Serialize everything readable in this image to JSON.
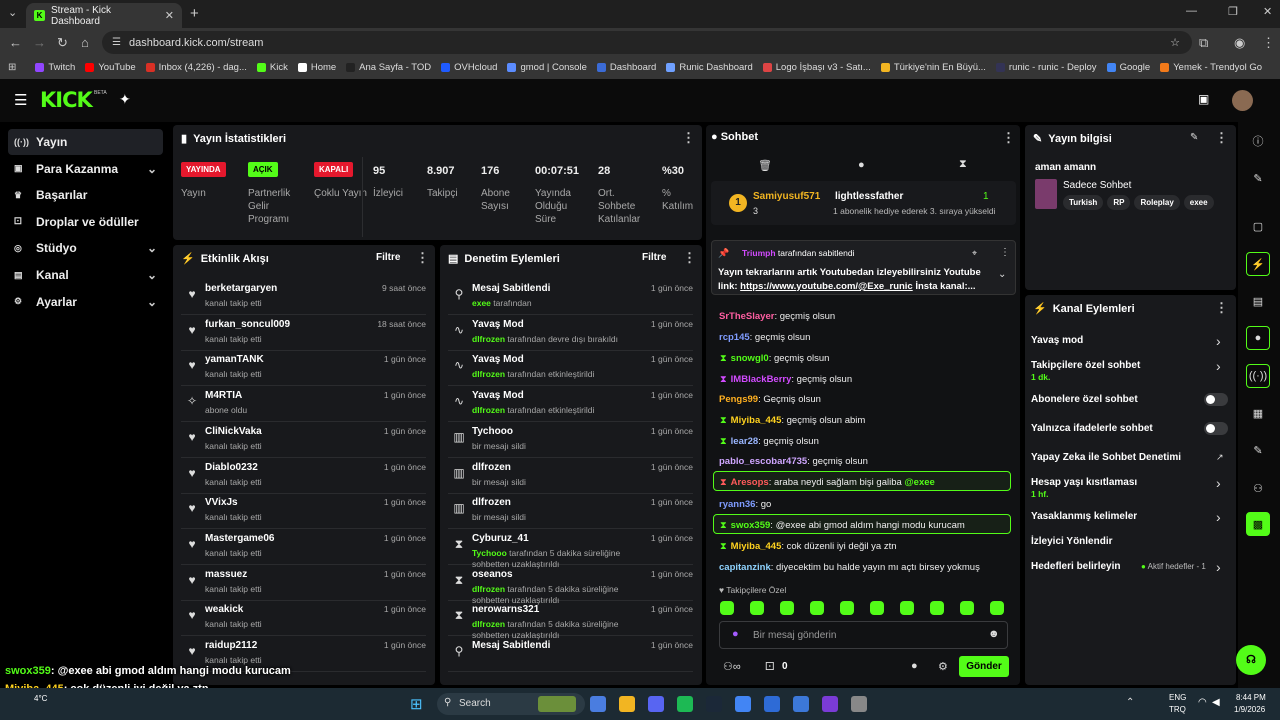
{
  "browser": {
    "tab_title": "Stream - Kick Dashboard",
    "url": "dashboard.kick.com/stream",
    "bookmarks": [
      "Twitch",
      "YouTube",
      "Inbox (4,226) - dag...",
      "Kick",
      "Home",
      "Ana Sayfa - TOD",
      "OVHcloud",
      "gmod | Console",
      "Dashboard",
      "Runic Dashboard",
      "Logo İşbaşı v3 - Satı...",
      "Türkiye'nin En Büyü...",
      "runic - runic - Deploy",
      "Google",
      "Yemek - Trendyol Go"
    ]
  },
  "kick": {
    "beta": "BETA"
  },
  "sidebar": {
    "items": [
      {
        "label": "Yayın",
        "icon": "broadcast-icon"
      },
      {
        "label": "Para Kazanma",
        "icon": "money-icon"
      },
      {
        "label": "Başarılar",
        "icon": "trophy-icon"
      },
      {
        "label": "Droplar ve ödüller",
        "icon": "gift-icon"
      },
      {
        "label": "Stüdyo",
        "icon": "studio-icon"
      },
      {
        "label": "Kanal",
        "icon": "channel-icon"
      },
      {
        "label": "Ayarlar",
        "icon": "gear-icon"
      }
    ]
  },
  "stats": {
    "title": "Yayın İstatistikleri",
    "badges": [
      {
        "text": "YAYINDA",
        "label": "Yayın",
        "color": "#e5182d"
      },
      {
        "text": "AÇIK",
        "label": "Partnerlik Gelir Programı",
        "color": "#53fc18"
      },
      {
        "text": "KAPALI",
        "label": "Çoklu Yayın",
        "color": "#e5182d"
      }
    ],
    "items": [
      {
        "value": "95",
        "label": "İzleyici"
      },
      {
        "value": "8.907",
        "label": "Takipçi"
      },
      {
        "value": "176",
        "label": "Abone Sayısı"
      },
      {
        "value": "00:07:51",
        "label": "Yayında Olduğu Süre"
      },
      {
        "value": "28",
        "label": "Ort. Sohbete Katılanlar"
      },
      {
        "value": "%30",
        "label": "% Katılım"
      }
    ]
  },
  "activity": {
    "title": "Etkinlik Akışı",
    "filter": "Filtre",
    "rows": [
      {
        "name": "berketargaryen",
        "sub": "kanalı takip etti",
        "time": "9 saat önce",
        "icon": "heart-icon"
      },
      {
        "name": "furkan_soncul009",
        "sub": "kanalı takip etti",
        "time": "18 saat önce",
        "icon": "heart-icon"
      },
      {
        "name": "yamanTANK",
        "sub": "kanalı takip etti",
        "time": "1 gün önce",
        "icon": "heart-icon"
      },
      {
        "name": "M4RTIA",
        "sub": "abone oldu",
        "time": "1 gün önce",
        "icon": "star-icon"
      },
      {
        "name": "CliNickVaka",
        "sub": "kanalı takip etti",
        "time": "1 gün önce",
        "icon": "heart-icon"
      },
      {
        "name": "Diablo0232",
        "sub": "kanalı takip etti",
        "time": "1 gün önce",
        "icon": "heart-icon"
      },
      {
        "name": "VVixJs",
        "sub": "kanalı takip etti",
        "time": "1 gün önce",
        "icon": "heart-icon"
      },
      {
        "name": "Mastergame06",
        "sub": "kanalı takip etti",
        "time": "1 gün önce",
        "icon": "heart-icon"
      },
      {
        "name": "massuez",
        "sub": "kanalı takip etti",
        "time": "1 gün önce",
        "icon": "heart-icon"
      },
      {
        "name": "weakick",
        "sub": "kanalı takip etti",
        "time": "1 gün önce",
        "icon": "heart-icon"
      },
      {
        "name": "raidup2112",
        "sub": "kanalı takip etti",
        "time": "1 gün önce",
        "icon": "heart-icon"
      }
    ]
  },
  "moderation": {
    "title": "Denetim Eylemleri",
    "filter": "Filtre",
    "rows": [
      {
        "name": "Mesaj Sabitlendi",
        "user": "exee",
        "sub": " tarafından",
        "time": "1 gün önce",
        "icon": "pin-icon"
      },
      {
        "name": "Yavaş Mod",
        "user": "dlfrozen",
        "sub": " tarafından devre dışı bırakıldı",
        "time": "1 gün önce",
        "icon": "snail-icon"
      },
      {
        "name": "Yavaş Mod",
        "user": "dlfrozen",
        "sub": " tarafından etkinleştirildi",
        "time": "1 gün önce",
        "icon": "snail-icon"
      },
      {
        "name": "Yavaş Mod",
        "user": "dlfrozen",
        "sub": " tarafından etkinleştirildi",
        "time": "1 gün önce",
        "icon": "snail-icon"
      },
      {
        "name": "Tychooo",
        "user": "",
        "sub": "bir mesajı sildi",
        "time": "1 gün önce",
        "icon": "trash-icon"
      },
      {
        "name": "dlfrozen",
        "user": "",
        "sub": "bir mesajı sildi",
        "time": "1 gün önce",
        "icon": "trash-icon"
      },
      {
        "name": "dlfrozen",
        "user": "",
        "sub": "bir mesajı sildi",
        "time": "1 gün önce",
        "icon": "trash-icon"
      },
      {
        "name": "Cyburuz_41",
        "user": "Tychooo",
        "sub": " tarafından 5 dakika süreliğine sohbetten uzaklaştırıldı",
        "time": "1 gün önce",
        "icon": "hourglass-icon"
      },
      {
        "name": "oseanos",
        "user": "dlfrozen",
        "sub": " tarafından 5 dakika süreliğine sohbetten uzaklaştırıldı",
        "time": "1 gün önce",
        "icon": "hourglass-icon"
      },
      {
        "name": "nerowarns321",
        "user": "dlfrozen",
        "sub": " tarafından 5 dakika süreliğine sohbetten uzaklaştırıldı",
        "time": "1 gün önce",
        "icon": "hourglass-icon"
      },
      {
        "name": "Mesaj Sabitlendi",
        "user": "",
        "sub": "",
        "time": "1 gün önce",
        "icon": "pin-icon"
      }
    ]
  },
  "chat": {
    "title": "Sohbet",
    "top_gifter": {
      "rank": "1",
      "name": "Samiyusuf571",
      "count": "3",
      "target": "lightlessfather",
      "subcount": "1",
      "note": "1 abonelik hediye ederek 3. sıraya yükseldi"
    },
    "pinned": {
      "author": "Triumph",
      "by": " tarafından sabitlendi",
      "text": "Yayın tekrarlarını artık Youtubedan izleyebilirsiniz Youtube link: ",
      "link": "https://www.youtube.com/@Exe_runic",
      "tail": " İnsta kanal:..."
    },
    "messages": [
      {
        "name": "SrTheSlayer",
        "color": "#ff5fa2",
        "text": ": geçmiş olsun",
        "hl": false
      },
      {
        "name": "rcp145",
        "color": "#7f9cff",
        "text": ": geçmiş olsun",
        "hl": false
      },
      {
        "name": "snowgl0",
        "color": "#53fc18",
        "text": ": geçmiş olsun",
        "hl": false
      },
      {
        "name": "IMBlackBerry",
        "color": "#d24bff",
        "text": ": geçmiş olsun",
        "hl": false
      },
      {
        "name": "Pengs99",
        "color": "#ffb020",
        "text": ": Geçmiş olsun",
        "hl": false
      },
      {
        "name": "Miyiba_445",
        "color": "#ffd21f",
        "text": ": geçmiş olsun abim",
        "hl": false
      },
      {
        "name": "lear28",
        "color": "#9ab6ff",
        "text": ": geçmiş olsun",
        "hl": false
      },
      {
        "name": "pablo_escobar4735",
        "color": "#cfa6ff",
        "text": ": geçmiş olsun",
        "hl": false
      },
      {
        "name": "Aresops",
        "color": "#ff5a5a",
        "text": ": araba neydi sağlam bişi galiba ",
        "mention": "@exee",
        "hl": true
      },
      {
        "name": "ryann36",
        "color": "#7f9cff",
        "text": ": go",
        "hl": false
      },
      {
        "name": "swox359",
        "color": "#53fc18",
        "text": ": @exee abi gmod aldım hangi modu kurucam",
        "hl": true
      },
      {
        "name": "Miyiba_445",
        "color": "#ffd21f",
        "text": ": cok düzenli iyi değil ya ztn",
        "hl": false
      },
      {
        "name": "capitanzink",
        "color": "#8fd3ff",
        "text": ": diyecektim bu halde yayın mı açtı birsey yokmuş",
        "hl": false
      }
    ],
    "followers_only": "Takipçilere Özel",
    "placeholder": "Bir mesaj gönderin",
    "points": "0",
    "send": "Gönder"
  },
  "info": {
    "title": "Yayın bilgisi",
    "stream_title": "aman amann",
    "category": "Sadece Sohbet",
    "tags": [
      "Turkish",
      "RP",
      "Roleplay",
      "exee"
    ]
  },
  "channel": {
    "title": "Kanal Eylemleri",
    "items": [
      {
        "label": "Yavaş mod",
        "sub": "",
        "ctrl": "chevron"
      },
      {
        "label": "Takipçilere özel sohbet",
        "sub": "1 dk.",
        "ctrl": "chevron"
      },
      {
        "label": "Abonelere özel sohbet",
        "sub": "",
        "ctrl": "toggle"
      },
      {
        "label": "Yalnızca ifadelerle sohbet",
        "sub": "",
        "ctrl": "toggle"
      },
      {
        "label": "Yapay Zeka ile Sohbet Denetimi",
        "sub": "",
        "ctrl": "external"
      },
      {
        "label": "Hesap yaşı kısıtlaması",
        "sub": "1 hf.",
        "ctrl": "chevron"
      },
      {
        "label": "Yasaklanmış kelimeler",
        "sub": "",
        "ctrl": "chevron"
      },
      {
        "label": "İzleyici Yönlendir",
        "sub": "",
        "ctrl": "none"
      },
      {
        "label": "Hedefleri belirleyin",
        "sub": "",
        "ctrl": "chevron"
      }
    ],
    "goals_status": "Aktif hedefler - 1"
  },
  "overlay": [
    {
      "name": "swox359",
      "text": ": @exee abi gmod aldım hangi modu kurucam",
      "color": "#53fc18"
    },
    {
      "name": "Miyiba_445",
      "text": ": cok düzenli iyi değil ya ztn",
      "color": "#ffd21f"
    },
    {
      "name": "capitanzink",
      "text": ": diyecektim bu halde yayın mı açtı birsey yokmuş",
      "color": "#ffffff"
    }
  ],
  "taskbar": {
    "weather": "4°C",
    "search": "Search",
    "lang1": "ENG",
    "lang2": "TRQ",
    "time": "8:44 PM",
    "date": "1/9/2026"
  }
}
